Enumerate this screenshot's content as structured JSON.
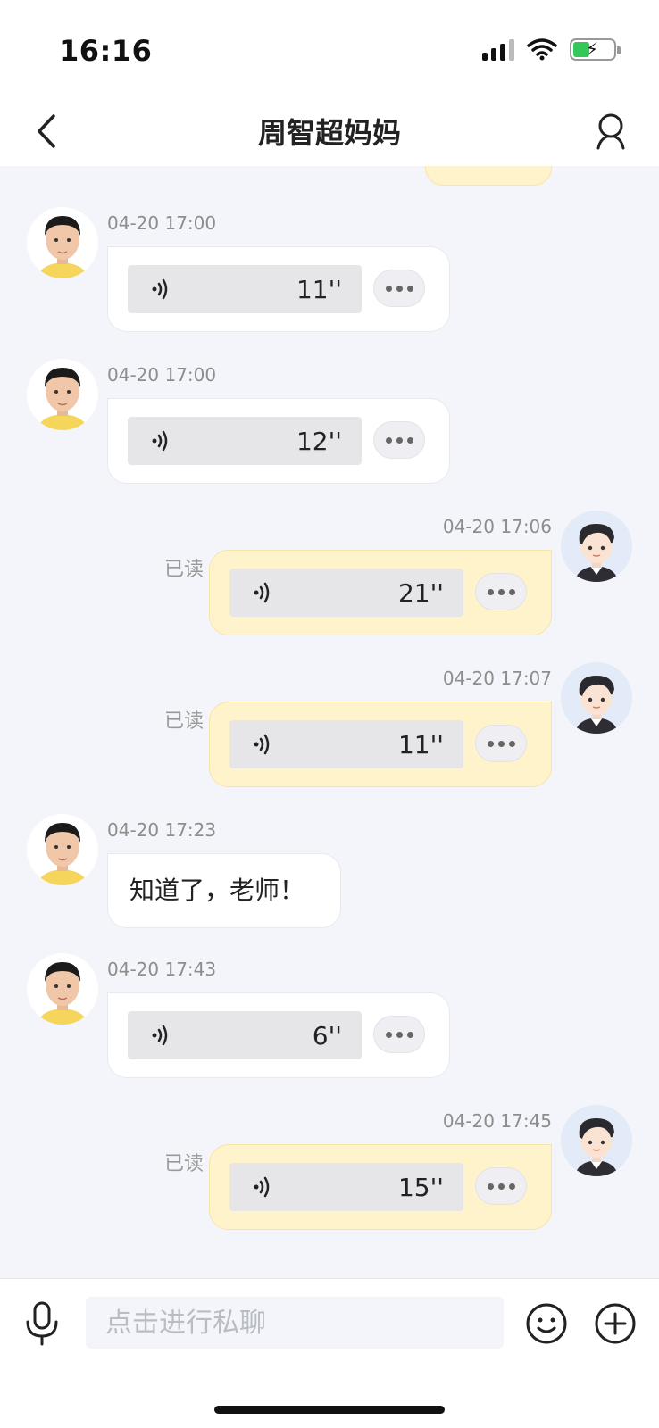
{
  "status_bar": {
    "time": "16:16",
    "icons": [
      "cellular-signal-icon",
      "wifi-icon",
      "battery-charging-icon"
    ]
  },
  "nav": {
    "title": "周智超妈妈",
    "back_icon": "chevron-left-icon",
    "profile_icon": "user-icon"
  },
  "messages": [
    {
      "side": "in",
      "time": "04-20 17:00",
      "type": "voice",
      "duration": "11''"
    },
    {
      "side": "in",
      "time": "04-20 17:00",
      "type": "voice",
      "duration": "12''"
    },
    {
      "side": "out",
      "time": "04-20 17:06",
      "type": "voice",
      "duration": "21''",
      "status": "已读"
    },
    {
      "side": "out",
      "time": "04-20 17:07",
      "type": "voice",
      "duration": "11''",
      "status": "已读"
    },
    {
      "side": "in",
      "time": "04-20 17:23",
      "type": "text",
      "text": "知道了，老师！"
    },
    {
      "side": "in",
      "time": "04-20 17:43",
      "type": "voice",
      "duration": "6''"
    },
    {
      "side": "out",
      "time": "04-20 17:45",
      "type": "voice",
      "duration": "15''",
      "status": "已读"
    }
  ],
  "input": {
    "placeholder": "点击进行私聊",
    "value": ""
  },
  "colors": {
    "incoming_bubble": "#ffffff",
    "outgoing_bubble": "#fff3cc",
    "background": "#f3f5fa",
    "timestamp": "#8d8d8d"
  }
}
